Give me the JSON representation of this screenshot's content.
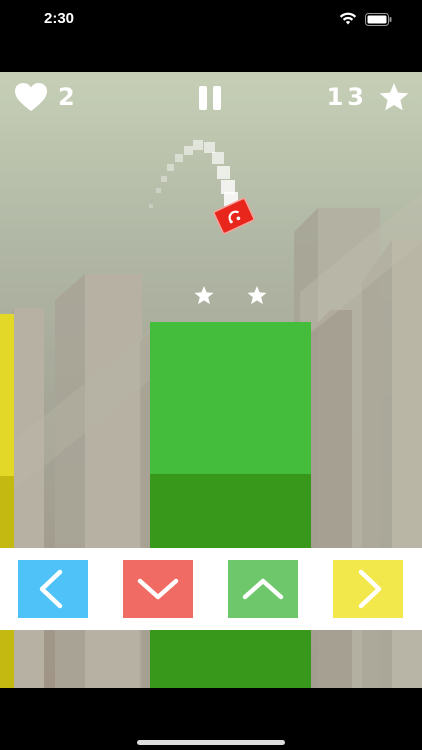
{
  "status_bar": {
    "time": "2:30",
    "icons": [
      "wifi-icon",
      "battery-icon"
    ]
  },
  "hud": {
    "lives_icon": "heart-icon",
    "lives": "2",
    "pause_icon": "pause-icon",
    "score": "13",
    "score_icon": "star-icon"
  },
  "collectibles": {
    "star_count": 2,
    "icon": "star-icon"
  },
  "player": {
    "icon": "red-cube-icon",
    "color": "#e8261c"
  },
  "controls": [
    {
      "action": "left",
      "icon": "chevron-left-icon",
      "color": "#4fc3f7"
    },
    {
      "action": "down",
      "icon": "chevron-down-icon",
      "color": "#f06b64"
    },
    {
      "action": "up",
      "icon": "chevron-up-icon",
      "color": "#6ec86b"
    },
    {
      "action": "right",
      "icon": "chevron-right-icon",
      "color": "#f2e84c"
    }
  ],
  "colors": {
    "green_pillar": "#44bd3c",
    "green_pillar_dark": "#37981c",
    "yellow_pillar": "#e3d827",
    "yellow_pillar_dark": "#c4b910",
    "sky_top": "#c6cfb6",
    "sky_bottom": "#a09486"
  }
}
